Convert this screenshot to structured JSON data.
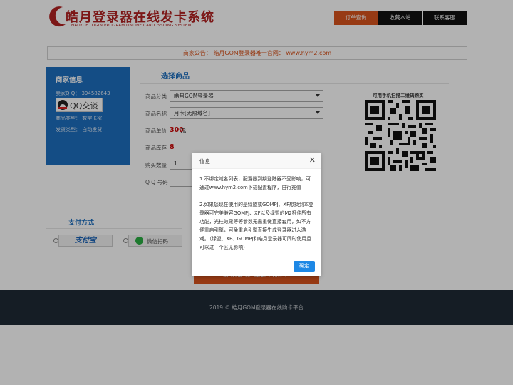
{
  "header": {
    "logo_title": "皓月登录器在线发卡系统",
    "logo_subtitle": "HAOYUE LOGIN PROGRAM ONLINE CARD ISSUING SYSTEM",
    "nav": [
      "订单查询",
      "收藏本站",
      "联系客服"
    ]
  },
  "notice": "商家公告：  皓月GOM登录器唯一官网：  www.hym2.com",
  "merchant": {
    "title": "商家信息",
    "qq_line": "卖家Q Q：  394582643",
    "qq_button": "QQ交谈",
    "type_line": "商品类型：  数字卡密",
    "ship_line": "发货类型：  自动发货"
  },
  "product": {
    "section_title": "选择商品",
    "category_label": "商品分类",
    "category_value": "皓月GOM登录器",
    "name_label": "商品名称",
    "name_value": "月卡[无限域名]",
    "price_label": "商品单价",
    "price_value": "300",
    "price_unit": "元",
    "stock_label": "商品库存",
    "stock_value": "8",
    "qty_label": "购买数量",
    "qty_value": "1",
    "qq_label": "Q Q 号码",
    "qr_caption": "可用手机扫描二维码购买"
  },
  "payment": {
    "title": "支付方式",
    "alipay_label": "支付宝",
    "wechat_label": "微信扫码"
  },
  "buy_button": "确认提交  立即付款  >",
  "footer": "2019 © 皓月GOM登录器在线购卡平台",
  "modal": {
    "title": "信息",
    "close": "✕",
    "para1": "1.不绑定域名列表，配置器到期登陆器不受影响，可通过www.hym2.com下载配置程序，自行充值",
    "para2": "2.如果您现在使用的是绿盟或GOMPJ、XF想换到本登录器可完美兼容GOMPJ、XF以及绿盟的M2插件所有功能，光柱效果等等参数无需重做直接套用，如不方便重启引擎，可免重启引擎直接生成登录器进入游戏。（绿盟、XF、GOMPJ和皓月登录器可同时使用且可以进一个区无影响）",
    "confirm": "确定"
  }
}
